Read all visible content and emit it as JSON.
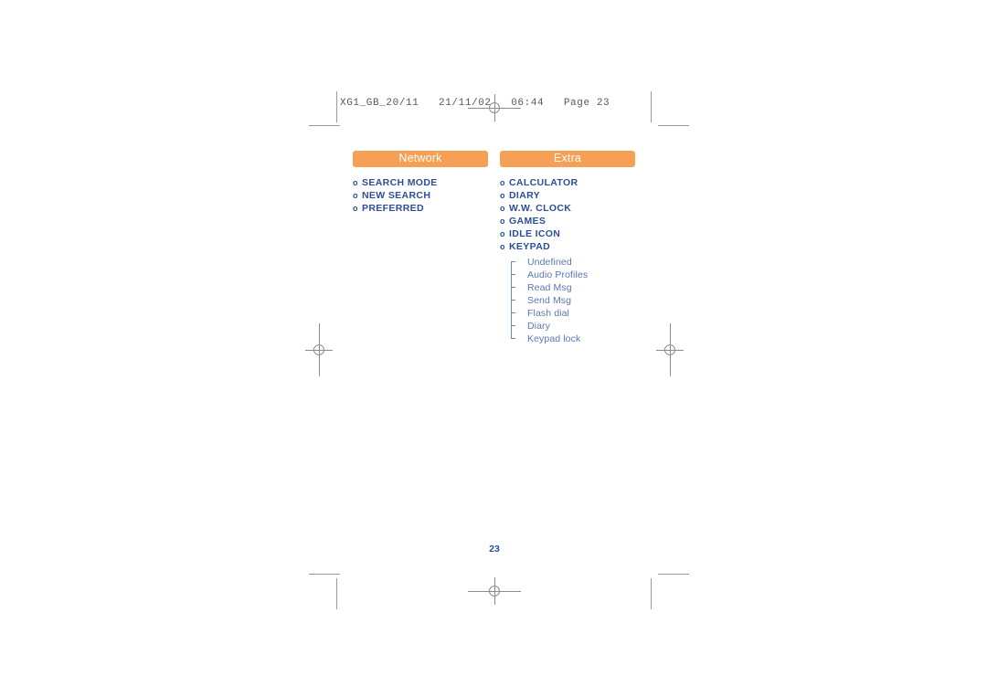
{
  "page": {
    "slug_line": "XG1_GB_20/11   21/11/02   06:44   Page 23",
    "folio": "23",
    "accent_color": "#f5a054",
    "heading_color": "#2a4f96",
    "subitem_color": "#5b77b5",
    "mark_color": "#9a9a9a"
  },
  "columns": [
    {
      "id": "network",
      "header": "Network",
      "bullet": "o",
      "items": [
        {
          "label": "SEARCH MODE"
        },
        {
          "label": "NEW SEARCH"
        },
        {
          "label": "PREFERRED"
        }
      ]
    },
    {
      "id": "extra",
      "header": "Extra",
      "bullet": "o",
      "items": [
        {
          "label": "CALCULATOR"
        },
        {
          "label": "DIARY"
        },
        {
          "label": "W.W. CLOCK"
        },
        {
          "label": "GAMES"
        },
        {
          "label": "IDLE ICON"
        },
        {
          "label": "KEYPAD"
        }
      ],
      "subitems": [
        {
          "label": "Undefined"
        },
        {
          "label": "Audio Profiles"
        },
        {
          "label": "Read Msg"
        },
        {
          "label": "Send Msg"
        },
        {
          "label": "Flash dial"
        },
        {
          "label": "Diary"
        },
        {
          "label": "Keypad lock"
        }
      ]
    }
  ]
}
